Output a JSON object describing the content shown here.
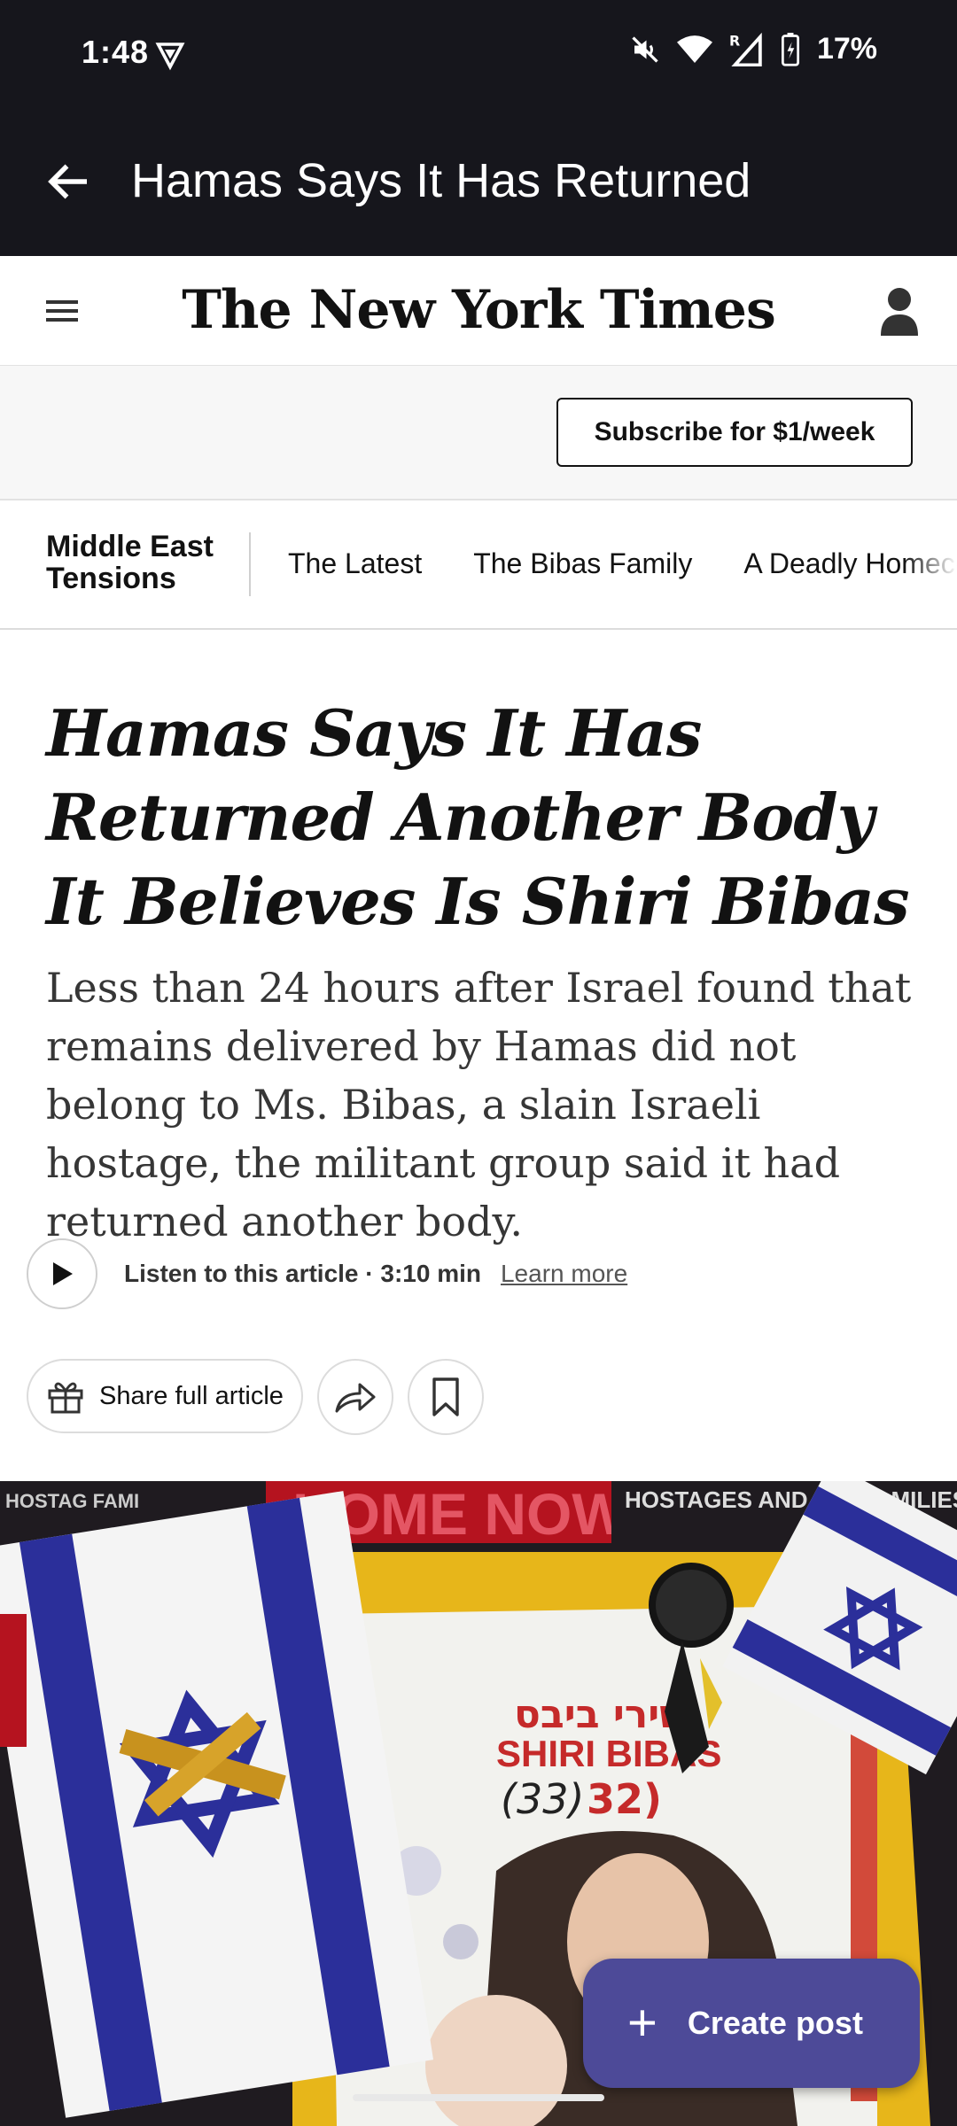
{
  "status_bar": {
    "time": "1:48",
    "battery": "17%"
  },
  "app_bar": {
    "title": "Hamas Says It Has Returned"
  },
  "nyt": {
    "logo": "The New York Times",
    "subscribe_label": "Subscribe for $1/week"
  },
  "section_nav": {
    "section_name_line1": "Middle East",
    "section_name_line2": "Tensions",
    "links": [
      "The Latest",
      "The Bibas Family",
      "A Deadly Homeco"
    ]
  },
  "article": {
    "headline_lines": [
      "Hamas Says It Has",
      "Returned Another Body",
      "It Believes Is Shiri Bibas"
    ],
    "summary": "Less than 24 hours after Israel found that remains delivered by Hamas did not belong to Ms. Bibas, a slain Israeli hostage, the militant group said it had returned another body.",
    "listen_label": "Listen to this article · 3:10 min",
    "learn_more": "Learn more",
    "share_label": "Share full article"
  },
  "photo": {
    "sign_banner": "HOME NOW!",
    "sign_left": "HOSTAG FAMI",
    "sign_right": "HOSTAGES AND MIS FAMILIES F",
    "poster_hebrew": "שירי ביבס",
    "poster_name": "SHIRI BIBAS",
    "poster_age": "(33)",
    "poster_age_overlay": "32)"
  },
  "fab": {
    "label": "Create post"
  },
  "colors": {
    "bar": "#16161c",
    "fab": "#4d4a98",
    "flag_blue": "#2b2f9a"
  }
}
